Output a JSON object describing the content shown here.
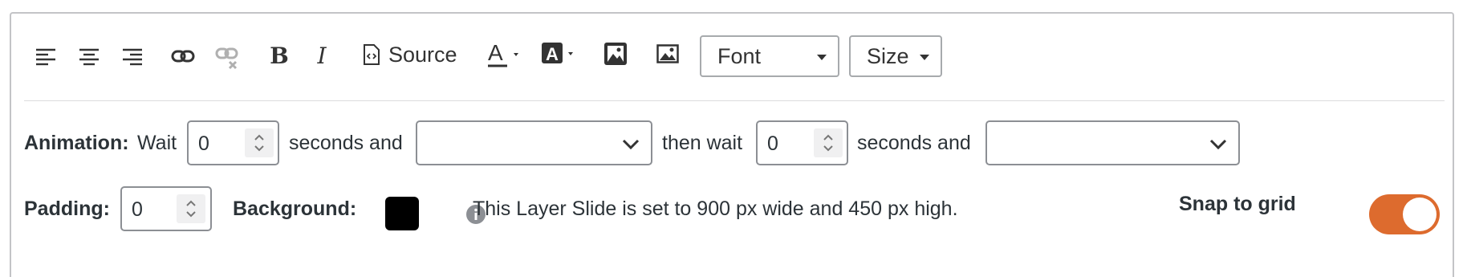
{
  "toolbar": {
    "icons": [
      "align-left-icon",
      "align-center-icon",
      "align-right-icon",
      "link-icon",
      "unlink-icon",
      "bold-icon",
      "italic-icon",
      "source-icon",
      "text-color-icon",
      "background-color-icon",
      "image-icon",
      "image2-icon"
    ],
    "source_label": "Source",
    "font_dropdown": "Font",
    "size_dropdown": "Size"
  },
  "animation": {
    "label": "Animation:",
    "wait_label": "Wait",
    "wait_value": "0",
    "seconds_and_1": "seconds and",
    "effect_in": "",
    "then_wait_label": "then wait",
    "then_wait_value": "0",
    "seconds_and_2": "seconds and",
    "effect_out": ""
  },
  "layout": {
    "padding_label": "Padding:",
    "padding_value": "0",
    "background_label": "Background:",
    "background_color": "#000000",
    "info_text": "This Layer Slide is set to 900 px wide and 450 px high.",
    "snap_label": "Snap to grid",
    "snap_on": true,
    "accent_color": "#dd6b2e"
  }
}
